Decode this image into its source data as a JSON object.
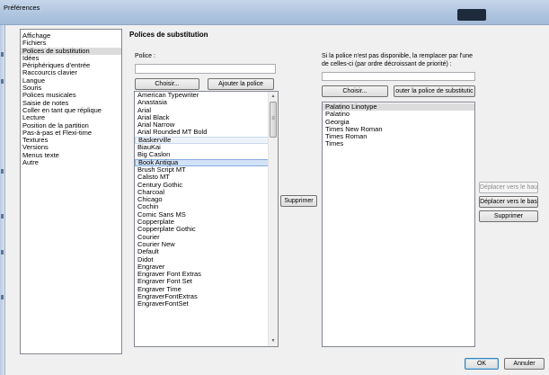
{
  "window": {
    "title": "Préférences"
  },
  "sidebar": {
    "selected_index": 2,
    "items": [
      "Affichage",
      "Fichiers",
      "Polices de substitution",
      "Idées",
      "Périphériques d'entrée",
      "Raccourcis clavier",
      "Langue",
      "Souris",
      "Polices musicales",
      "Saisie de notes",
      "Coller en tant que réplique",
      "Lecture",
      "Position de la partition",
      "Pas-à-pas et Flexi-time",
      "Textures",
      "Versions",
      "Menus texte",
      "Autre"
    ]
  },
  "main": {
    "title": "Polices de substitution",
    "police_label": "Police :",
    "police_value": "",
    "choose_button": "Choisir...",
    "add_font_button": "Ajouter la police",
    "font_list": {
      "selected": "Book Antiqua",
      "highlighted": "Baskerville",
      "items": [
        "American Typewriter",
        "Anastasia",
        "Arial",
        "Arial Black",
        "Arial Narrow",
        "Arial Rounded MT Bold",
        "Baskerville",
        "BiauKai",
        "Big Caslon",
        "Book Antiqua",
        "Brush Script MT",
        "Calisto MT",
        "Century Gothic",
        "Charcoal",
        "Chicago",
        "Cochin",
        "Comic Sans MS",
        "Copperplate",
        "Copperplate Gothic",
        "Courier",
        "Courier New",
        "Default",
        "Didot",
        "Engraver",
        "Engraver Font Extras",
        "Engraver Font Set",
        "Engraver Time",
        "EngraverFontExtras",
        "EngraverFontSet"
      ]
    },
    "remove_button": "Supprimer"
  },
  "substitution": {
    "label": "Si la police n'est pas disponible, la remplacer par l'une de celles-ci (par ordre décroissant de priorité) :",
    "value": "",
    "choose_button": "Choisir...",
    "add_button": "outer la police de substitutic",
    "list": {
      "selected": "Palatino Linotype",
      "items": [
        "Palatino Linotype",
        "Palatino",
        "Georgia",
        "Times New Roman",
        "Times Roman",
        "Times"
      ]
    },
    "move_up_button": "Déplacer vers le haut",
    "move_down_button": "Déplacer vers le bas",
    "remove_button": "Supprimer"
  },
  "footer": {
    "ok_button": "OK",
    "cancel_button": "Annuler"
  }
}
